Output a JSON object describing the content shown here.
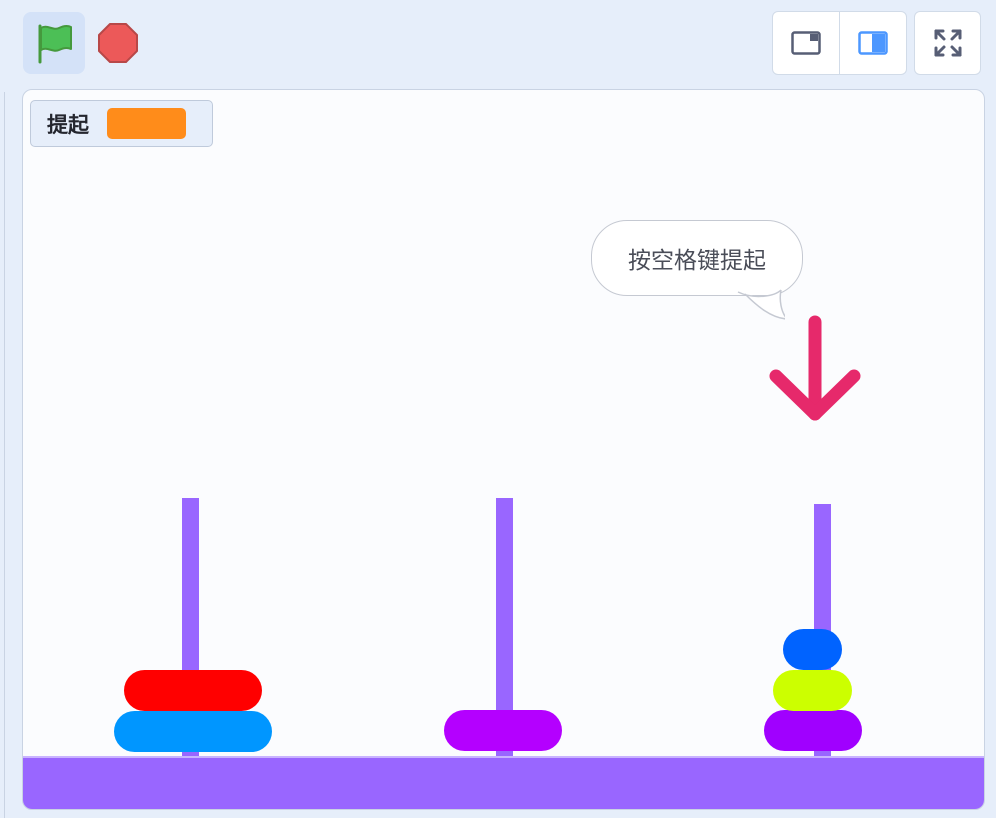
{
  "toolbar": {
    "green_flag_icon": "green-flag-icon",
    "stop_icon": "stop-sign-icon",
    "small_stage_icon": "small-stage-layout-icon",
    "large_stage_icon": "large-stage-layout-icon",
    "fullscreen_icon": "fullscreen-icon"
  },
  "monitor": {
    "label": "提起",
    "value": ""
  },
  "speech": {
    "text": "按空格键提起"
  },
  "colors": {
    "flag": "#4cbf56",
    "stop": "#ec5959",
    "monitor_value": "#ff8c1a",
    "pole": "#9966ff",
    "ground": "#9966ff",
    "arrow": "#e6296b",
    "layout_active": "#4c97ff"
  },
  "game": {
    "rods": [
      {
        "name": "left",
        "discs": [
          {
            "color": "#0096ff",
            "size": "large"
          },
          {
            "color": "#ff0000",
            "size": "large"
          }
        ]
      },
      {
        "name": "middle",
        "discs": [
          {
            "color": "#b400ff",
            "size": "medium"
          }
        ]
      },
      {
        "name": "right",
        "discs": [
          {
            "color": "#a000ff",
            "size": "medium"
          },
          {
            "color": "#ccff00",
            "size": "small"
          },
          {
            "color": "#0063ff",
            "size": "smallest"
          }
        ]
      }
    ],
    "pointer_icon": "down-arrow-icon"
  }
}
